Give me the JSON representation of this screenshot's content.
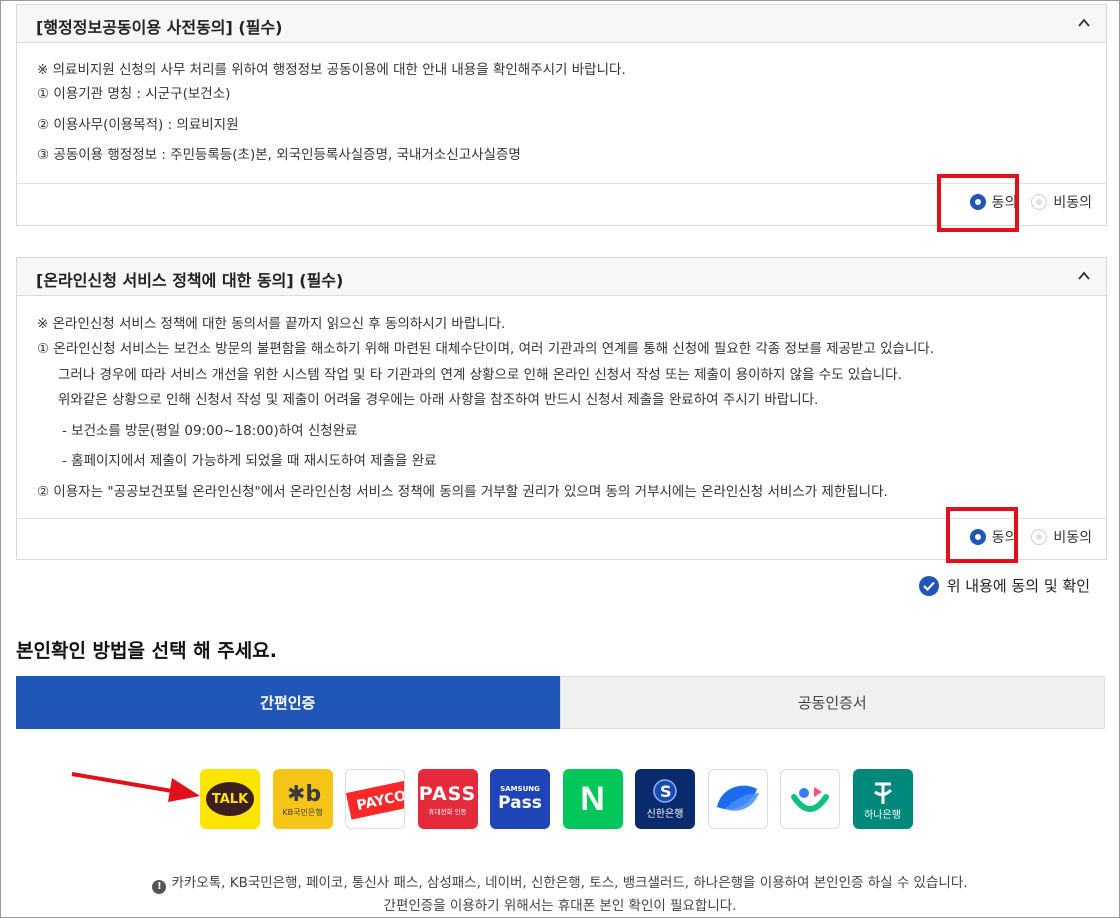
{
  "section1": {
    "title": "[행정정보공동이용 사전동의] (필수)",
    "lines": [
      "※ 의료비지원 신청의 사무 처리를 위하여 행정정보 공동이용에 대한 안내 내용을 확인해주시기 바랍니다.",
      "①  이용기관 명칭 : 시군구(보건소)",
      "②  이용사무(이용목적) : 의료비지원",
      "③  공동이용 행정정보 : 주민등록등(초)본, 외국인등록사실증명, 국내거소신고사실증명"
    ],
    "agree": "동의",
    "disagree": "비동의"
  },
  "section2": {
    "title": "[온라인신청 서비스 정책에 대한 동의] (필수)",
    "lines": [
      "※ 온라인신청 서비스 정책에 대한 동의서를 끝까지 읽으신 후 동의하시기 바랍니다.",
      "①  온라인신청 서비스는 보건소 방문의 불편함을 해소하기 위해 마련된 대체수단이며, 여러 기관과의 연계를 통해 신청에 필요한 각종 정보를 제공받고 있습니다.",
      "그러나 경우에 따라 서비스 개선을 위한 시스템 작업 및 타 기관과의 연계 상황으로 인해 온라인 신청서 작성 또는 제출이 용이하지 않을 수도 있습니다.",
      "위와같은 상황으로 인해 신청서 작성 및 제출이 어려울 경우에는 아래 사항을 참조하여 반드시 신청서 제출을 완료하여 주시기 바랍니다.",
      "-  보건소를 방문(평일 09:00~18:00)하여 신청완료",
      "-  홈페이지에서 제출이 가능하게 되었을 때 재시도하여 제출을 완료",
      "②  이용자는 \"공공보건포털 온라인신청\"에서 온라인신청 서비스 정책에 동의를 거부할 권리가 있으며 동의 거부시에는 온라인신청 서비스가 제한됩니다."
    ],
    "agree": "동의",
    "disagree": "비동의"
  },
  "confirm_label": "위 내용에 동의 및 확인",
  "identity_heading": "본인확인 방법을 선택 해 주세요.",
  "tabs": [
    "간편인증",
    "공동인증서"
  ],
  "providers": {
    "kakao": "TALK",
    "kb_sub": "KB국민은행",
    "payco": "PAYCO",
    "pass": "PASS",
    "pass_sub": "휴대전화 인증",
    "samsung_top": "SAMSUNG",
    "samsung_main": "Pass",
    "naver": "N",
    "shinhan": "신한은행",
    "hana": "하나은행"
  },
  "notice_line1": "카카오톡, KB국민은행, 페이코, 통신사 패스, 삼성패스, 네이버, 신한은행, 토스, 뱅크샐러드, 하나은행을 이용하여 본인인증 하실 수 있습니다.",
  "notice_line2": "간편인증을 이용하기 위해서는 휴대폰 본인 확인이 필요합니다.",
  "colors": {
    "accent": "#1f56b8",
    "highlight": "#e0111a"
  }
}
